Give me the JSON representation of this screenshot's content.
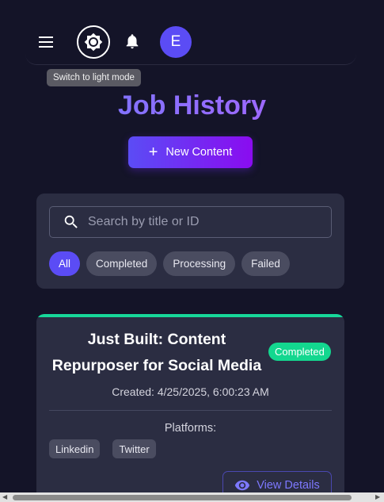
{
  "header": {
    "avatar_initial": "E",
    "tooltip": "Switch to light mode"
  },
  "page": {
    "title": "Job History",
    "new_button_label": "New Content",
    "new_button_icon": "+"
  },
  "filters": {
    "search_placeholder": "Search by title or ID",
    "search_value": "",
    "chips": [
      {
        "label": "All",
        "active": true
      },
      {
        "label": "Completed",
        "active": false
      },
      {
        "label": "Processing",
        "active": false
      },
      {
        "label": "Failed",
        "active": false
      }
    ]
  },
  "jobs": [
    {
      "title": "Just Built: Content Repurposer for Social Media",
      "status": "Completed",
      "status_color": "#13d78f",
      "created": "Created: 4/25/2025, 6:00:23 AM",
      "platforms_label": "Platforms:",
      "platforms": [
        "Linkedin",
        "Twitter"
      ],
      "view_label": "View Details"
    }
  ],
  "colors": {
    "accent": "#5b4cf5",
    "background": "#141428",
    "card": "#2b2d42",
    "success": "#13d78f"
  }
}
